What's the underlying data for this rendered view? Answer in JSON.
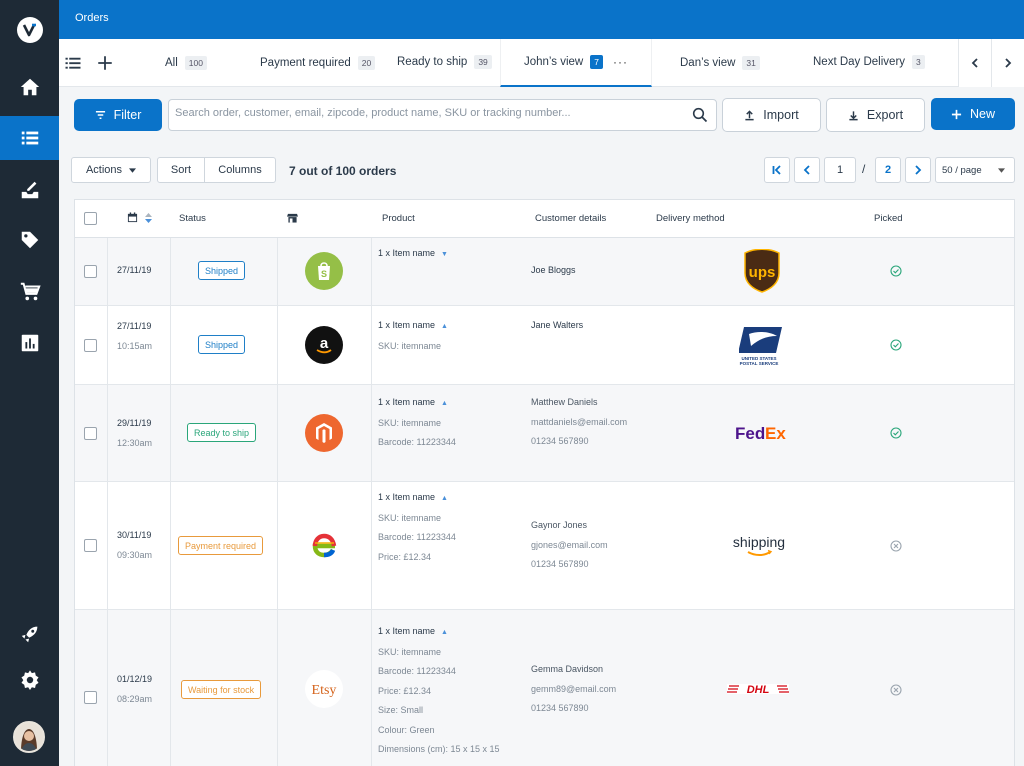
{
  "app": {
    "title": "Orders"
  },
  "tabs": [
    {
      "label": "All",
      "count": "100"
    },
    {
      "label": "Payment required",
      "count": "20"
    },
    {
      "label": "Ready to ship",
      "count": "39"
    },
    {
      "label": "John’s view",
      "count": "7",
      "more": "···"
    },
    {
      "label": "Dan’s view",
      "count": "31"
    },
    {
      "label": "Next Day Delivery",
      "count": "3"
    }
  ],
  "toolbar": {
    "filter_label": "Filter",
    "search_placeholder": "Search order, customer, email, zipcode, product name, SKU or tracking number...",
    "import_label": "Import",
    "export_label": "Export",
    "new_label": "New"
  },
  "actions": {
    "actions_label": "Actions",
    "sort_label": "Sort",
    "columns_label": "Columns",
    "count_label": "7 out of 100 orders"
  },
  "pagination": {
    "current": "1",
    "sep": "/",
    "total": "2",
    "per_page": "50 / page"
  },
  "table": {
    "headers": {
      "status": "Status",
      "product": "Product",
      "customer": "Customer details",
      "delivery": "Delivery method",
      "picked": "Picked"
    },
    "rows": [
      {
        "date": "27/11/19",
        "time": "",
        "status": "Shipped",
        "store": "shopify",
        "product_lines": [
          "1 x Item name"
        ],
        "expanded": false,
        "customer_lines": [
          "Joe Bloggs"
        ],
        "carrier": "ups",
        "picked": true
      },
      {
        "date": "27/11/19",
        "time": "10:15am",
        "status": "Shipped",
        "store": "amazon",
        "product_lines": [
          "1 x Item name",
          "SKU: itemname"
        ],
        "expanded": true,
        "customer_lines": [
          "Jane Walters"
        ],
        "carrier": "usps",
        "picked": true
      },
      {
        "date": "29/11/19",
        "time": "12:30am",
        "status": "Ready to ship",
        "store": "magento",
        "product_lines": [
          "1 x Item name",
          "SKU: itemname",
          "Barcode: 11223344"
        ],
        "expanded": true,
        "customer_lines": [
          "Matthew Daniels",
          "mattdaniels@email.com",
          "01234 567890"
        ],
        "carrier": "fedex",
        "picked": true
      },
      {
        "date": "30/11/19",
        "time": "09:30am",
        "status": "Payment required",
        "store": "ebay",
        "product_lines": [
          "1 x Item name",
          "SKU: itemname",
          "Barcode: 11223344",
          "Price: £12.34"
        ],
        "expanded": true,
        "customer_lines": [
          "Gaynor Jones",
          "gjones@email.com",
          "01234 567890"
        ],
        "carrier": "amazon-shipping",
        "picked": false
      },
      {
        "date": "01/12/19",
        "time": "08:29am",
        "status": "Waiting for stock",
        "store": "etsy",
        "product_lines": [
          "1 x Item name",
          "SKU: itemname",
          "Barcode: 11223344",
          "Price: £12.34",
          "Size: Small",
          "Colour: Green",
          "Dimensions (cm): 15 x 15 x 15"
        ],
        "expanded": true,
        "customer_lines": [
          "Gemma Davidson",
          "gemm89@email.com",
          "01234 567890"
        ],
        "carrier": "dhl",
        "picked": false
      }
    ]
  },
  "logos": {
    "ups": "ups",
    "usps_line1": "UNITED STATES",
    "usps_line2": "POSTAL SERVICE",
    "fedex_fed": "Fed",
    "fedex_ex": "Ex",
    "shipping": "shipping",
    "dhl": "DHL",
    "amazon": "a",
    "etsy": "Etsy",
    "ebay": "e"
  },
  "colors": {
    "primary": "#0a73c9",
    "sidebar": "#1e2a36",
    "shipped": "#1f7fc7",
    "ready": "#2aa67a",
    "payment": "#e89a3c",
    "waiting": "#e89a3c",
    "picked": "#2aa67a",
    "not_picked": "#9aa4ae"
  }
}
